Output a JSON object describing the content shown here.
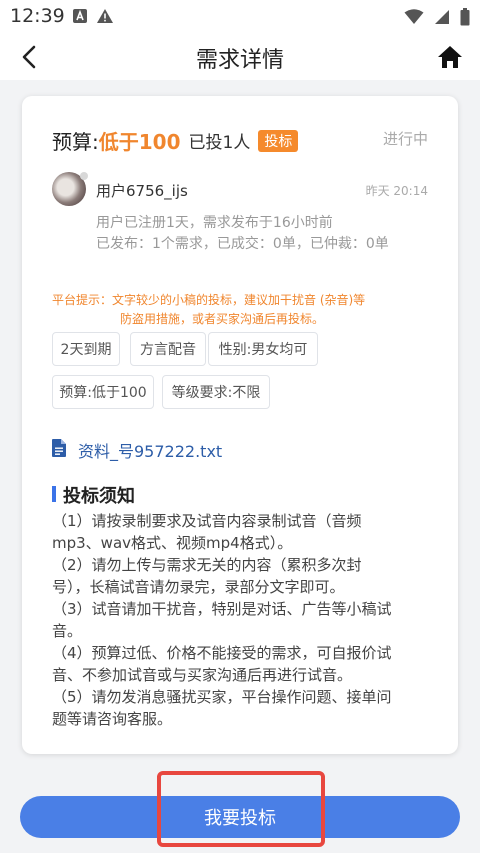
{
  "status_bar": {
    "time": "12:39",
    "icons": [
      "a-notification-icon",
      "warning-icon",
      "wifi-icon",
      "signal-icon",
      "battery-icon"
    ]
  },
  "nav": {
    "title": "需求详情"
  },
  "card": {
    "budget_label": "预算:",
    "budget_value": "低于100",
    "bid_count": "已投1人",
    "bid_tag": "投标",
    "status": "进行中",
    "user": {
      "name": "用户6756_ijs",
      "time": "昨天 20:14",
      "meta1": "用户已注册1天，需求发布于16小时前",
      "meta2": "已发布：1个需求，已成交：0单，已仲裁：0单"
    },
    "tip_line1": "平台提示：文字较少的小稿的投标，建议加干扰音 (杂音)等",
    "tip_line2": "防盗用措施，或者买家沟通后再投标。",
    "tags": [
      "2天到期",
      "方言配音",
      "性别:男女均可",
      "预算:低于100",
      "等级要求:不限"
    ],
    "file_name": "资料_号957222.txt",
    "notice_title": "投标须知",
    "notice_lines": [
      "（1）请按录制要求及试音内容录制试音（音频",
      "mp3、wav格式、视频mp4格式）。",
      "（2）请勿上传与需求无关的内容（累积多次封",
      "号），长稿试音请勿录完，录部分文字即可。",
      "（3）试音请加干扰音，特别是对话、广告等小稿试",
      "音。",
      "（4）预算过低、价格不能接受的需求，可自报价试",
      "音、不参加试音或与买家沟通后再进行试音。",
      "（5）请勿发消息骚扰买家，平台操作问题、接单问",
      "题等请咨询客服。"
    ]
  },
  "bottom_button": "我要投标",
  "colors": {
    "accent_orange": "#f0862e",
    "primary_blue": "#4a7fe6",
    "link_blue": "#2d5da8",
    "highlight_red": "#e8473f"
  }
}
